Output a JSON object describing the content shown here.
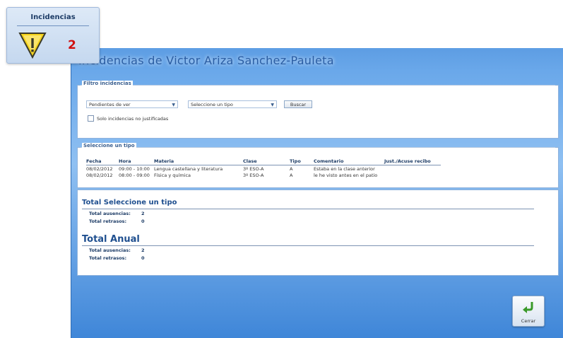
{
  "widget": {
    "title": "Incidencias",
    "count": "2",
    "icon": "warning-icon"
  },
  "window": {
    "title": "Incidencias de Victor Ariza Sanchez-Pauleta"
  },
  "filter": {
    "legend": "Filtro incidencias",
    "status_select": "Pendientes de ver",
    "type_select": "Seleccione un tipo",
    "search_button": "Buscar",
    "checkbox_label": "Solo incidencias no justificadas"
  },
  "list": {
    "legend": "Seleccione un tipo",
    "columns": [
      "Fecha",
      "Hora",
      "Materia",
      "Clase",
      "Tipo",
      "Comentario",
      "Just./Acuse recibo"
    ],
    "rows": [
      [
        "08/02/2012",
        "09:00 - 10:00",
        "Lengua castellana y literatura",
        "3º ESO-A",
        "A",
        "Estaba en la clase anterior",
        ""
      ],
      [
        "08/02/2012",
        "08:00 - 09:00",
        "Física y química",
        "3º ESO-A",
        "A",
        "le he visto antes en el patio",
        ""
      ]
    ]
  },
  "totals_type": {
    "title": "Total Seleccione un tipo",
    "ausencias_label": "Total ausencias:",
    "ausencias_value": "2",
    "retrasos_label": "Total retrasos:",
    "retrasos_value": "0"
  },
  "totals_year": {
    "title": "Total Anual",
    "ausencias_label": "Total ausencias:",
    "ausencias_value": "2",
    "retrasos_label": "Total retrasos:",
    "retrasos_value": "0"
  },
  "close_button": {
    "label": "Cerrar",
    "icon": "return-arrow-icon"
  },
  "colors": {
    "accent": "#4a8fdc",
    "title_blue": "#2a5da3",
    "count_red": "#d01010"
  }
}
